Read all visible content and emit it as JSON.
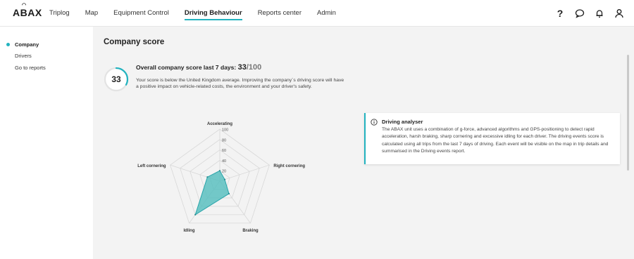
{
  "app": {
    "logo": "ABAX"
  },
  "nav": {
    "items": [
      {
        "label": "Triplog"
      },
      {
        "label": "Map"
      },
      {
        "label": "Equipment Control"
      },
      {
        "label": "Driving Behaviour"
      },
      {
        "label": "Reports center"
      },
      {
        "label": "Admin"
      }
    ],
    "active_index": 3
  },
  "header_icons": {
    "help_icon": "help-icon",
    "help_badge": "",
    "chat_icon": "chat-icon",
    "bell_icon": "bell-icon",
    "bell_badge": "",
    "user_icon": "user-icon"
  },
  "sidebar": {
    "items": [
      {
        "label": "Company"
      },
      {
        "label": "Drivers"
      },
      {
        "label": "Go to reports"
      }
    ],
    "active_index": 0
  },
  "page": {
    "title": "Company score"
  },
  "score": {
    "headline": "Overall company score last 7 days:",
    "value": "33",
    "out_of": "/100",
    "ring_value": "33",
    "description": "Your score is below the United Kingdom average. Improving the company`s driving score will have a positive impact on vehicle-related costs, the environment and your driver's safety."
  },
  "radar": {
    "axes": [
      "Accelerating",
      "Right cornering",
      "Braking",
      "Idling",
      "Left cornering"
    ],
    "ticks": [
      "100",
      "80",
      "60",
      "40",
      "20"
    ],
    "values": [
      20,
      10,
      30,
      80,
      25
    ],
    "max": 100,
    "fill_color": "#5bbfc0"
  },
  "info": {
    "title": "Driving analyser",
    "text": "The ABAX unit uses a combination of g-force, advanced algorithms and GPS-positioning to detect rapid acceleration, harsh braking, sharp cornering and excessive idling for each driver. The driving events score is calculated using all trips from the last 7 days of driving. Each event will be visible on the map in trip details and summarised in the Driving events report."
  },
  "colors": {
    "accent": "#22b3bf",
    "badge": "#f0a400"
  }
}
